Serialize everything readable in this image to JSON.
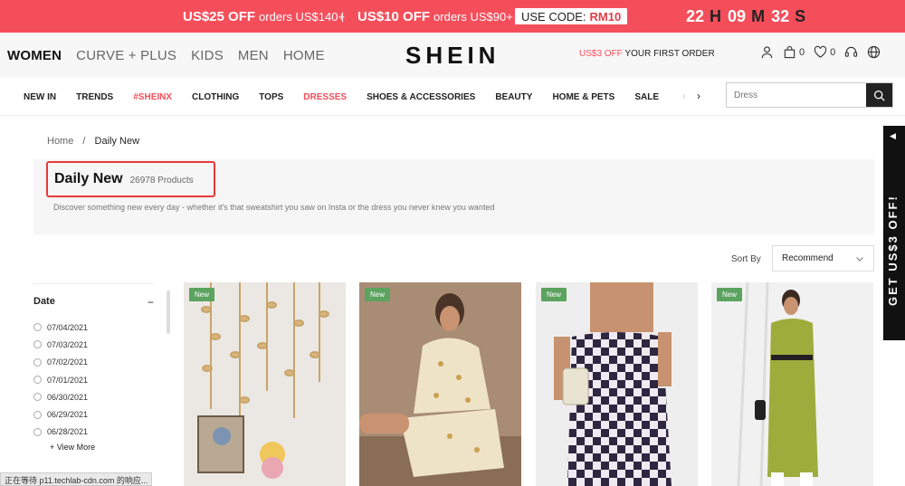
{
  "promo": {
    "offer1_amount": "US$25 OFF",
    "offer1_cond": "orders US$140+",
    "separator": "|",
    "offer2_amount": "US$10 OFF",
    "offer2_cond": "orders US$90+",
    "code_label": "USE CODE:",
    "code_value": "RM10",
    "timer": {
      "h": "22",
      "h_unit": "H",
      "m": "09",
      "m_unit": "M",
      "s": "32",
      "s_unit": "S"
    }
  },
  "header": {
    "categories": [
      "WOMEN",
      "CURVE + PLUS",
      "KIDS",
      "MEN",
      "HOME"
    ],
    "logo": "SHEIN",
    "first_order_hl": "US$3 OFF",
    "first_order_rest": " YOUR FIRST ORDER",
    "cart_count": "0",
    "wish_count": "0"
  },
  "nav": {
    "items": [
      "NEW IN",
      "TRENDS",
      "#SHEINX",
      "CLOTHING",
      "TOPS",
      "DRESSES",
      "SHOES & ACCESSORIES",
      "BEAUTY",
      "HOME & PETS",
      "SALE"
    ],
    "prev_arrow": "‹",
    "next_arrow": "›",
    "search_placeholder": "Dress"
  },
  "breadcrumb": {
    "home": "Home",
    "slash": "/",
    "current": "Daily New"
  },
  "title": {
    "heading": "Daily New",
    "count": "26978 Products",
    "description": "Discover something new every day - whether it's that sweatshirt you saw on Insta or the dress you never knew you wanted"
  },
  "sort": {
    "label": "Sort By",
    "value": "Recommend"
  },
  "filter": {
    "heading": "Date",
    "toggle": "−",
    "dates": [
      "07/04/2021",
      "07/03/2021",
      "07/02/2021",
      "07/01/2021",
      "06/30/2021",
      "06/29/2021",
      "06/28/2021"
    ],
    "view_more": "+ View More"
  },
  "products": [
    {
      "badge": "New",
      "image": "wall-garland-decor"
    },
    {
      "badge": "New",
      "image": "floral-pajama-set"
    },
    {
      "badge": "New",
      "image": "checkered-cami-dress"
    },
    {
      "badge": "New",
      "image": "green-knit-dress"
    }
  ],
  "side_tab": {
    "arrow": "◀",
    "text": "GET US$3 OFF!"
  },
  "status_bar": "正在等待 p11.techlab-cdn.com 的响应..."
}
